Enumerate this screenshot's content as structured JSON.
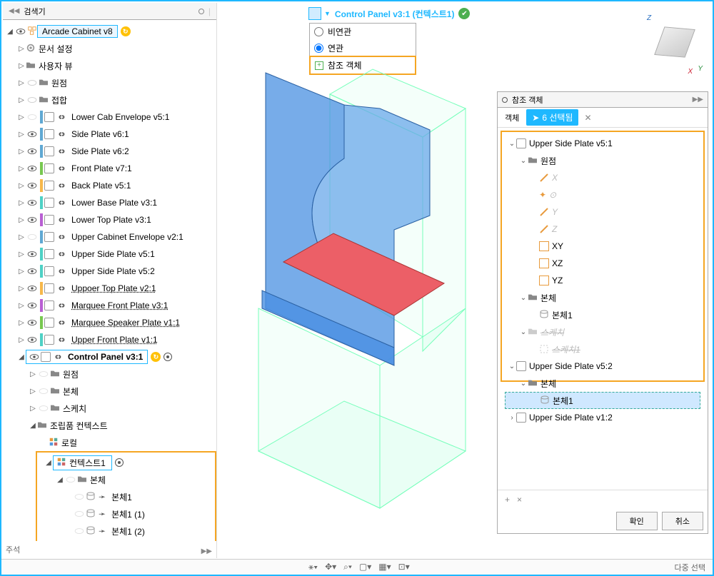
{
  "browser": {
    "title": "검색기",
    "root": "Arcade Cabinet v8",
    "items_basic": [
      {
        "label": "문서 설정",
        "type": "gear"
      },
      {
        "label": "사용자 뷰",
        "type": "folder"
      },
      {
        "label": "원점",
        "type": "folder",
        "eyeOff": true
      },
      {
        "label": "접합",
        "type": "folder",
        "eyeOff": true
      }
    ],
    "components": [
      {
        "label": "Lower Cab Envelope v5:1",
        "color": "#5fa8d3",
        "eyeOff": true
      },
      {
        "label": "Side Plate v6:1",
        "color": "#5fa8d3"
      },
      {
        "label": "Side Plate v6:2",
        "color": "#5fa8d3"
      },
      {
        "label": "Front Plate v7:1",
        "color": "#78c850"
      },
      {
        "label": "Back Plate v5:1",
        "color": "#f7b84b"
      },
      {
        "label": "Lower Base Plate v3:1",
        "color": "#4ed1c5"
      },
      {
        "label": "Lower Top Plate v3:1",
        "color": "#b95fd3"
      },
      {
        "label": "Upper Cabinet Envelope v2:1",
        "color": "#5fa8d3",
        "eyeOff": true
      },
      {
        "label": "Upper Side Plate v5:1",
        "color": "#4ed1c5"
      },
      {
        "label": "Upper Side Plate v5:2",
        "color": "#4ed1c5"
      },
      {
        "label": "Uppoer Top Plate v2:1",
        "color": "#f7b84b",
        "dashed": true
      },
      {
        "label": "Marquee Front Plate v3:1",
        "color": "#b95fd3",
        "dashed": true
      },
      {
        "label": "Marquee Speaker Plate v1:1",
        "color": "#78c850",
        "dashed": true
      },
      {
        "label": "Upper Front Plate v1:1",
        "color": "#4ed1c5",
        "dashed": true
      }
    ],
    "control_panel": {
      "label": "Control Panel v3:1",
      "children": [
        {
          "label": "원점"
        },
        {
          "label": "본체"
        },
        {
          "label": "스케치"
        }
      ],
      "assembly_context": "조립품 컨텍스트",
      "local": "로컬",
      "context_name": "컨텍스트1",
      "bodies_header": "본체",
      "bodies": [
        "본체1",
        "본체1 (1)",
        "본체1 (2)"
      ]
    }
  },
  "annotate_label": "주석",
  "topComp": {
    "name": "Control Panel v3:1 (컨텍스트1)",
    "opts": [
      "비연관",
      "연관"
    ],
    "ref_obj": "참조 객체"
  },
  "refPanel": {
    "title": "참조 객체",
    "tab_obj": "객체",
    "sel_count": "6 선택됨",
    "root1": "Upper Side Plate v5:1",
    "origin": "원점",
    "axes": [
      "X",
      "Y",
      "Z"
    ],
    "origin_pt": "⊙",
    "planes": [
      "XY",
      "XZ",
      "YZ"
    ],
    "body_folder": "본체",
    "body1": "본체1",
    "sketch_folder": "스케치",
    "sketch1": "스케치1",
    "root2": "Upper Side Plate v5:2",
    "root3": "Upper Side Plate v1:2",
    "ok": "확인",
    "cancel": "취소"
  },
  "multi_select": "다중 선택"
}
